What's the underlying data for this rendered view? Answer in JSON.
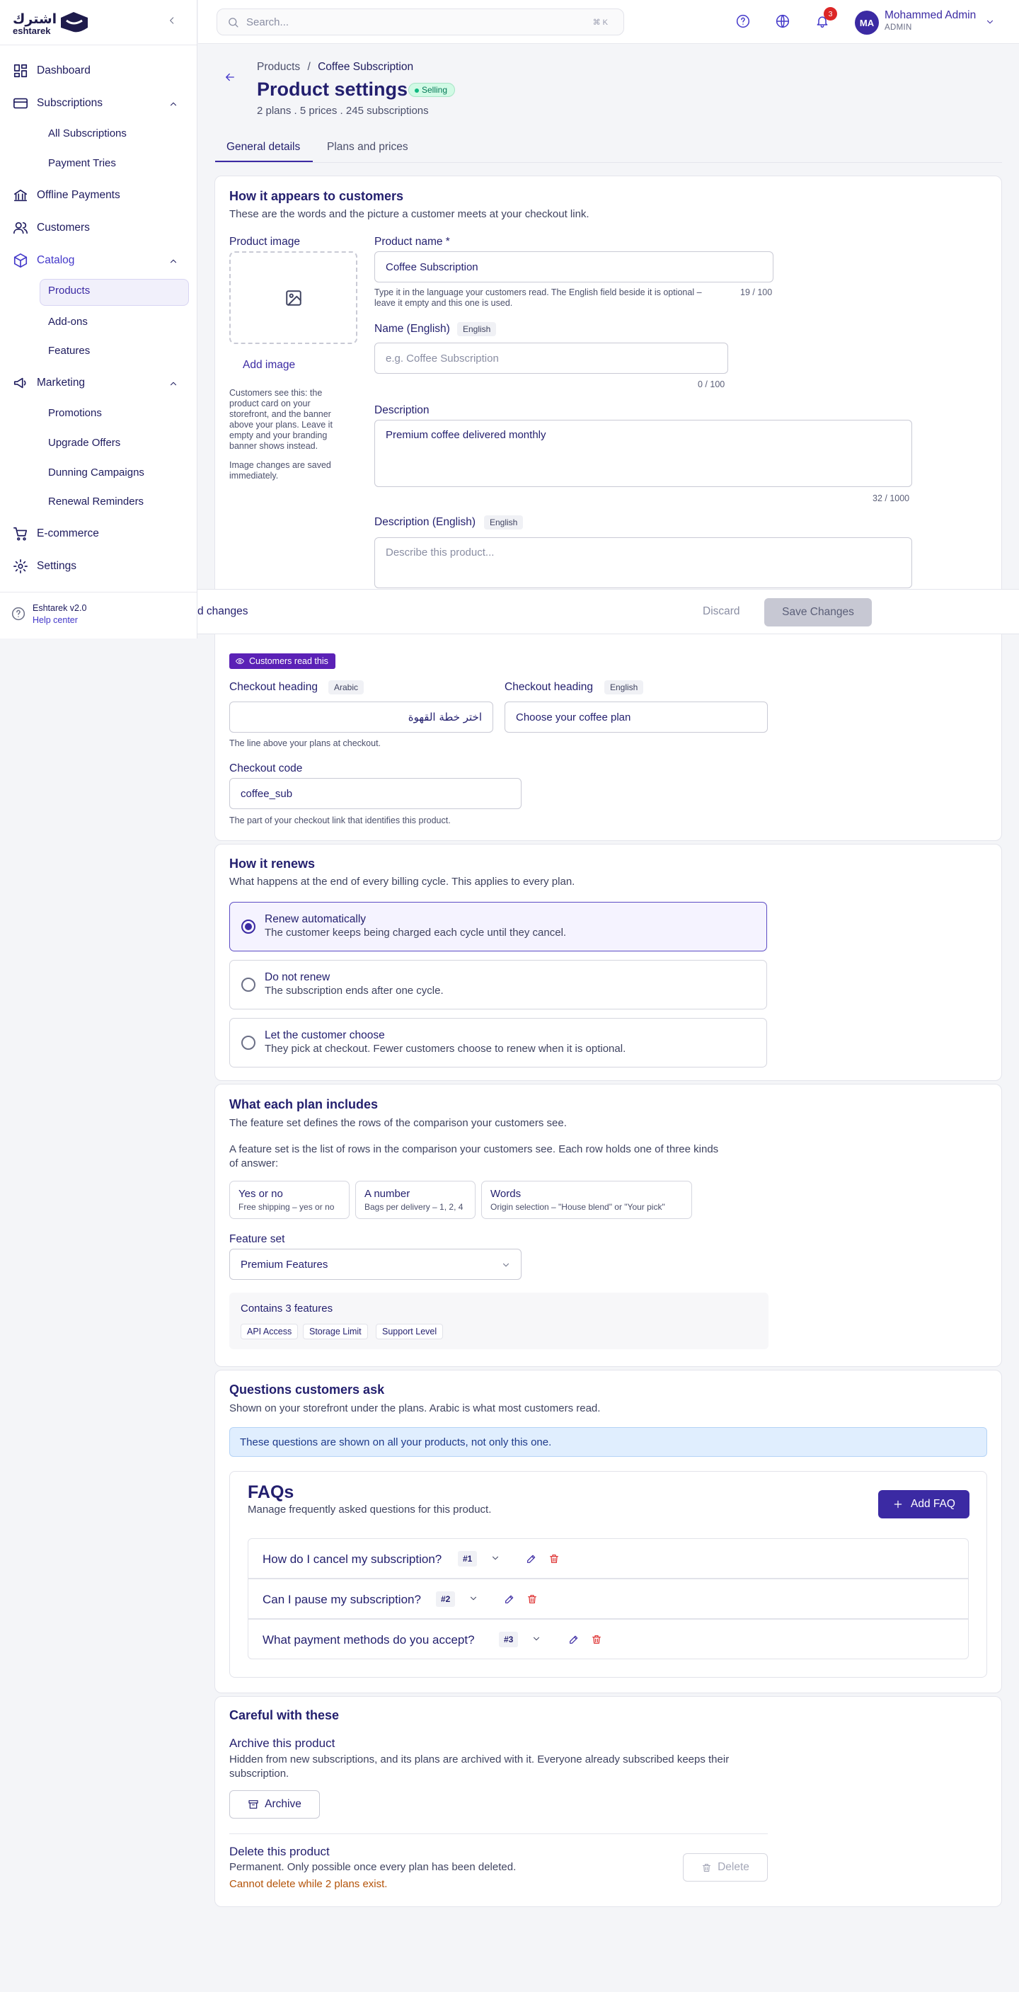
{
  "brand": {
    "name": "eshtarek",
    "arabic": "اشترك"
  },
  "sidebar": {
    "items": [
      {
        "label": "Dashboard",
        "icon": "dashboard-icon"
      },
      {
        "label": "Subscriptions",
        "icon": "card-icon"
      },
      {
        "label": "All Subscriptions"
      },
      {
        "label": "Payment Tries"
      },
      {
        "label": "Offline Payments",
        "icon": "bank-icon"
      },
      {
        "label": "Customers",
        "icon": "users-icon"
      },
      {
        "label": "Catalog",
        "icon": "box-icon"
      },
      {
        "label": "Products"
      },
      {
        "label": "Add-ons"
      },
      {
        "label": "Features"
      },
      {
        "label": "Marketing",
        "icon": "megaphone-icon"
      },
      {
        "label": "Promotions"
      },
      {
        "label": "Upgrade Offers"
      },
      {
        "label": "Dunning Campaigns"
      },
      {
        "label": "Renewal Reminders"
      },
      {
        "label": "E-commerce",
        "icon": "cart-icon"
      },
      {
        "label": "Settings",
        "icon": "gear-icon"
      }
    ],
    "version": "Eshtarek v2.0",
    "help": "Help center"
  },
  "header": {
    "search_placeholder": "Search...",
    "shortcut": "⌘ K",
    "notifications": "3",
    "avatar": "MA",
    "user_name": "Mohammed Admin",
    "user_role": "ADMIN"
  },
  "page": {
    "breadcrumb": [
      "Products",
      "Coffee Subscription"
    ],
    "title": "Product settings",
    "status": "Selling",
    "meta": "2 plans . 5 prices . 245 subscriptions",
    "tabs": [
      "General details",
      "Plans and prices"
    ]
  },
  "appearance": {
    "title": "How it appears to customers",
    "subtitle": "These are the words and the picture a customer meets at your checkout link.",
    "image_label": "Product image",
    "add_image": "Add image",
    "image_help1": "Customers see this: the product card on your storefront, and the banner above your plans. Leave it empty and your branding banner shows instead.",
    "image_help2": "Image changes are saved immediately.",
    "name_label": "Product name *",
    "name_value": "Coffee Subscription",
    "name_help": "Type it in the language your customers read. The English field beside it is optional – leave it empty and this one is used.",
    "name_count": "19 / 100",
    "name_en_label": "Name (English)",
    "english_tag": "English",
    "arabic_tag": "Arabic",
    "name_en_placeholder": "e.g. Coffee Subscription",
    "name_en_count": "0 / 100",
    "desc_label": "Description",
    "desc_value": "Premium coffee delivered monthly",
    "desc_count": "32 / 1000",
    "desc_en_label": "Description (English)",
    "desc_en_placeholder": "Describe this product..."
  },
  "savebar": {
    "text": "d changes",
    "discard": "Discard",
    "save": "Save Changes"
  },
  "checkout": {
    "badge": "Customers read this",
    "heading_label": "Checkout heading",
    "heading_ar": "اختر خطة القهوة",
    "heading_en": "Choose your coffee plan",
    "heading_help": "The line above your plans at checkout.",
    "code_label": "Checkout code",
    "code_value": "coffee_sub",
    "code_help": "The part of your checkout link that identifies this product."
  },
  "renew": {
    "title": "How it renews",
    "subtitle": "What happens at the end of every billing cycle. This applies to every plan.",
    "options": [
      {
        "title": "Renew automatically",
        "desc": "The customer keeps being charged each cycle until they cancel.",
        "selected": true
      },
      {
        "title": "Do not renew",
        "desc": "The subscription ends after one cycle.",
        "selected": false
      },
      {
        "title": "Let the customer choose",
        "desc": "They pick at checkout. Fewer customers choose to renew when it is optional.",
        "selected": false
      }
    ]
  },
  "plan_includes": {
    "title": "What each plan includes",
    "subtitle": "The feature set defines the rows of the comparison your customers see.",
    "explain": "A feature set is the list of rows in the comparison your customers see. Each row holds one of three kinds of answer:",
    "kinds": [
      {
        "title": "Yes or no",
        "desc": "Free shipping – yes or no"
      },
      {
        "title": "A number",
        "desc": "Bags per delivery – 1, 2, 4"
      },
      {
        "title": "Words",
        "desc": "Origin selection – \"House blend\" or \"Your pick\""
      }
    ],
    "feature_set_label": "Feature set",
    "feature_set_value": "Premium Features",
    "contains": "Contains 3 features",
    "features": [
      "API Access",
      "Storage Limit",
      "Support Level"
    ]
  },
  "questions": {
    "title": "Questions customers ask",
    "subtitle": "Shown on your storefront under the plans. Arabic is what most customers read.",
    "note": "These questions are shown on all your products, not only this one.",
    "faq_title": "FAQs",
    "faq_subtitle": "Manage frequently asked questions for this product.",
    "add_faq": "Add FAQ",
    "items": [
      {
        "q": "How do I cancel my subscription?",
        "n": "#1"
      },
      {
        "q": "Can I pause my subscription?",
        "n": "#2"
      },
      {
        "q": "What payment methods do you accept?",
        "n": "#3"
      }
    ]
  },
  "danger": {
    "title": "Careful with these",
    "archive_title": "Archive this product",
    "archive_desc": "Hidden from new subscriptions, and its plans are archived with it. Everyone already subscribed keeps their subscription.",
    "archive_btn": "Archive",
    "delete_title": "Delete this product",
    "delete_desc": "Permanent. Only possible once every plan has been deleted.",
    "delete_warn": "Cannot delete while 2 plans exist.",
    "delete_btn": "Delete"
  },
  "colors": {
    "accent": "#3b2aa3",
    "danger": "#dc2626",
    "success": "#10b981",
    "warning": "#b45309"
  }
}
